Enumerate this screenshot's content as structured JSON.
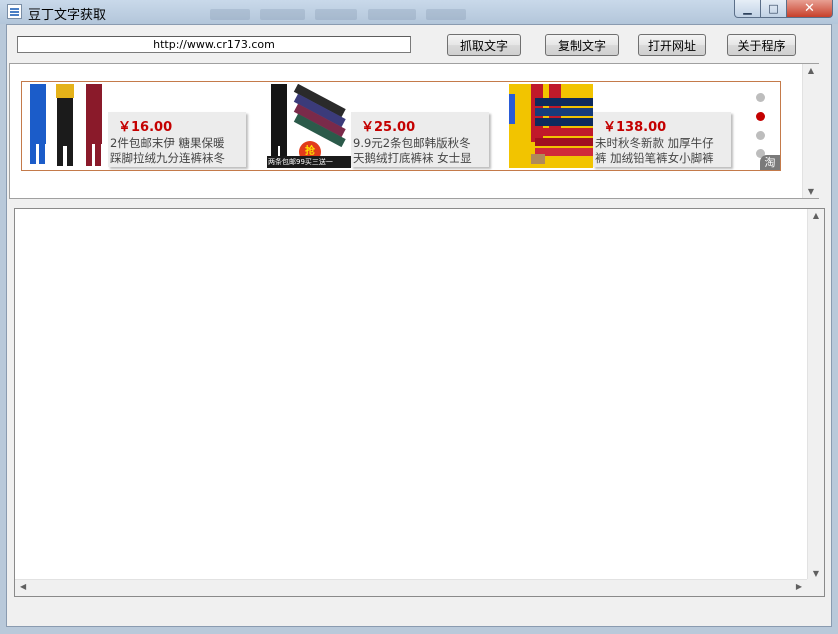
{
  "window": {
    "title": "豆丁文字获取",
    "minimize_glyph": "▁",
    "maximize_glyph": "□",
    "close_glyph": "✕"
  },
  "toolbar": {
    "url_value": "http://www.cr173.com",
    "grab_text_label": "抓取文字",
    "copy_text_label": "复制文字",
    "open_url_label": "打开网址",
    "about_label": "关于程序"
  },
  "ads": {
    "items": [
      {
        "price": "￥16.00",
        "desc_line1": "2件包邮末伊  糖果保暖",
        "desc_line2": "踩脚拉绒九分连裤袜冬",
        "image": "leggings-photo"
      },
      {
        "price": "￥25.00",
        "desc_line1": "9.9元2条包邮韩版秋冬",
        "desc_line2": "天鹅绒打底裤袜 女士显",
        "image": "tights-promo-photo",
        "image_text_top": "抢",
        "image_text_bottom": "两条包邮99买三送一"
      },
      {
        "price": "￥138.00",
        "desc_line1": "未时秋冬新款  加厚牛仔",
        "desc_line2": "裤  加绒铅笔裤女小脚裤",
        "image": "red-jeans-photo"
      }
    ],
    "carousel_dots": 4,
    "active_dot_index": 1,
    "badge_text": "淘",
    "colors": {
      "price": "#c40000",
      "border": "#c47a4a",
      "active_dot": "#c40000"
    }
  },
  "output": {
    "text": ""
  }
}
